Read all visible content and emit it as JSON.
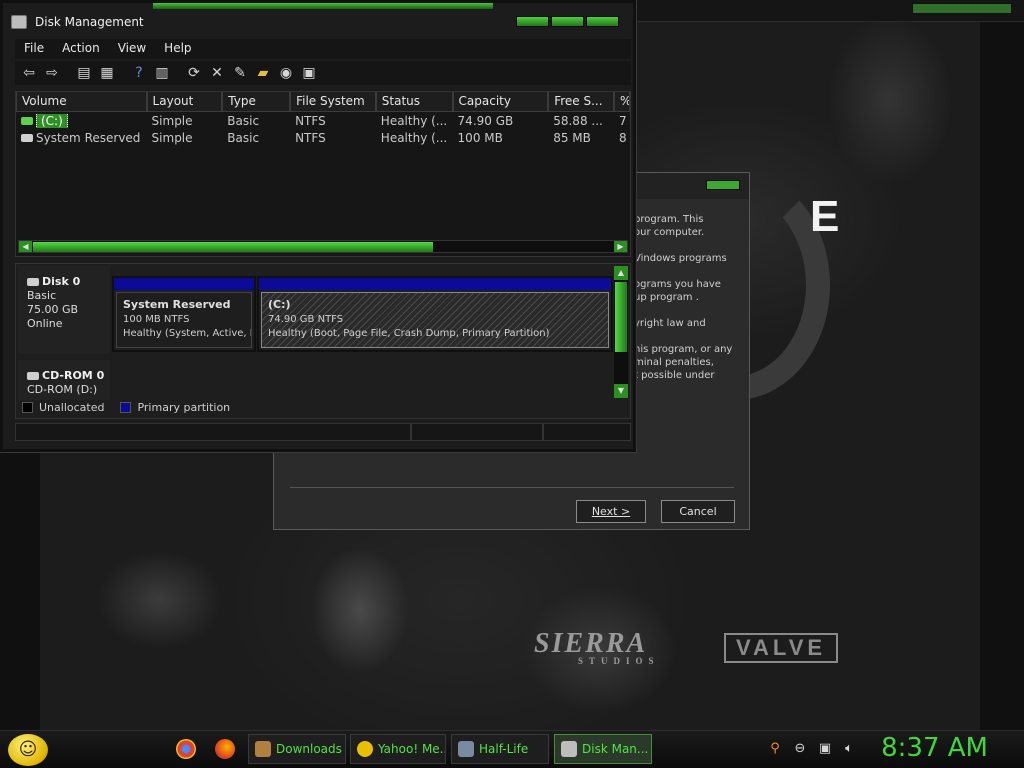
{
  "desktop": {
    "splash_letter": "E",
    "publisher_logo": "SIERRA",
    "publisher_sub": "STUDIOS",
    "developer_logo": "VALVE"
  },
  "setup_dialog": {
    "paragraphs": [
      "program. This\nour computer.",
      "Vindows programs",
      "ograms you have\nup program .",
      "yright law and",
      "his program, or any\nminal penalties,\nt possible under"
    ],
    "next_label": "Next >",
    "cancel_label": "Cancel"
  },
  "disk_management": {
    "title": "Disk Management",
    "menu": [
      "File",
      "Action",
      "View",
      "Help"
    ],
    "toolbar_icons": [
      "back-arrow-icon",
      "forward-arrow-icon",
      "console-tree-icon",
      "properties-icon",
      "help-icon",
      "show-hide-icon",
      "refresh-icon",
      "delete-icon",
      "rescan-icon",
      "open-folder-icon",
      "explore-icon",
      "settings-icon"
    ],
    "columns": [
      "Volume",
      "Layout",
      "Type",
      "File System",
      "Status",
      "Capacity",
      "Free S...",
      "%"
    ],
    "volumes": [
      {
        "volume": "(C:)",
        "layout": "Simple",
        "type": "Basic",
        "fs": "NTFS",
        "status": "Healthy (...",
        "capacity": "74.90 GB",
        "free": "58.88 ...",
        "pct": "7"
      },
      {
        "volume": "System Reserved",
        "layout": "Simple",
        "type": "Basic",
        "fs": "NTFS",
        "status": "Healthy (...",
        "capacity": "100 MB",
        "free": "85 MB",
        "pct": "8"
      }
    ],
    "disks": [
      {
        "name": "Disk 0",
        "kind": "Basic",
        "size": "75.00 GB",
        "state": "Online"
      },
      {
        "name": "CD-ROM 0",
        "kind": "CD-ROM (D:)"
      }
    ],
    "partitions": [
      {
        "name": "System Reserved",
        "size": "100 MB NTFS",
        "status": "Healthy (System, Active, P"
      },
      {
        "name": "(C:)",
        "size": "74.90 GB NTFS",
        "status": "Healthy (Boot, Page File, Crash Dump, Primary Partition)"
      }
    ],
    "legend": [
      "Unallocated",
      "Primary partition"
    ],
    "colors": {
      "unallocated": "#000000",
      "primary": "#0b0b95",
      "accent": "#3fa830"
    }
  },
  "taskbar": {
    "tasks": [
      "Downloads",
      "Yahoo! Me...",
      "Half-Life",
      "Disk Man..."
    ],
    "clock": "8:37 AM",
    "quicklaunch": [
      "chrome-icon",
      "firefox-icon"
    ],
    "tray": [
      "search-icon",
      "messenger-icon",
      "network-icon",
      "volume-icon"
    ]
  }
}
